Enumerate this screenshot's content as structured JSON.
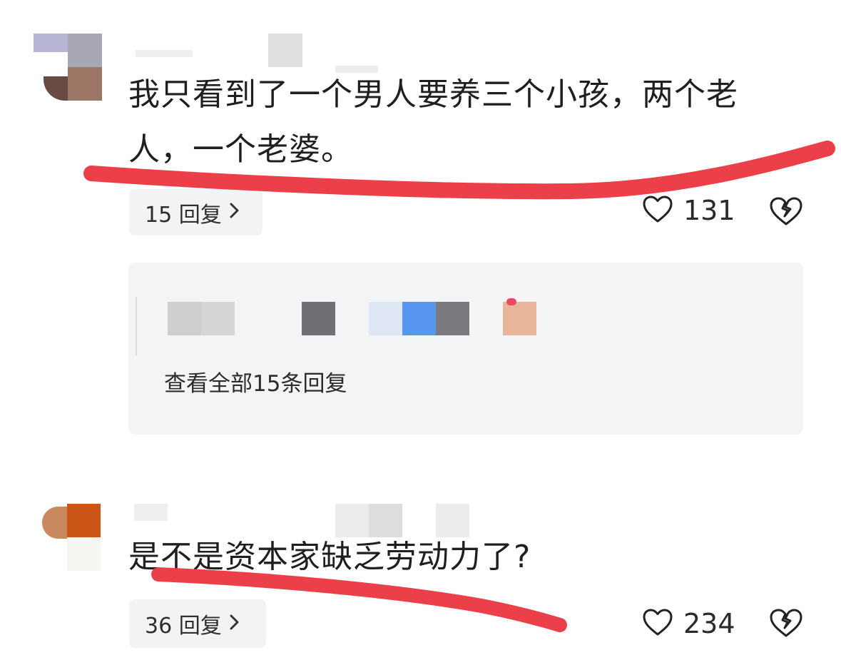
{
  "comments": [
    {
      "text_line1": "我只看到了一个男人要养三个小孩，两个老",
      "text_line2": "人，一个老婆。",
      "reply_label": "15 回复",
      "like_count": "131",
      "replies_panel": {
        "view_all_label": "查看全部15条回复"
      }
    },
    {
      "text_line1": "是不是资本家缺乏劳动力了?",
      "reply_label": "36 回复",
      "like_count": "234"
    }
  ],
  "icons": {
    "like": "heart-outline-icon",
    "dislike": "broken-heart-icon",
    "chevron": "chevron-right-icon"
  },
  "colors": {
    "annotation_stroke": "#ea3a43",
    "panel_background": "#f3f4f6",
    "pill_background": "#f2f3f5"
  }
}
